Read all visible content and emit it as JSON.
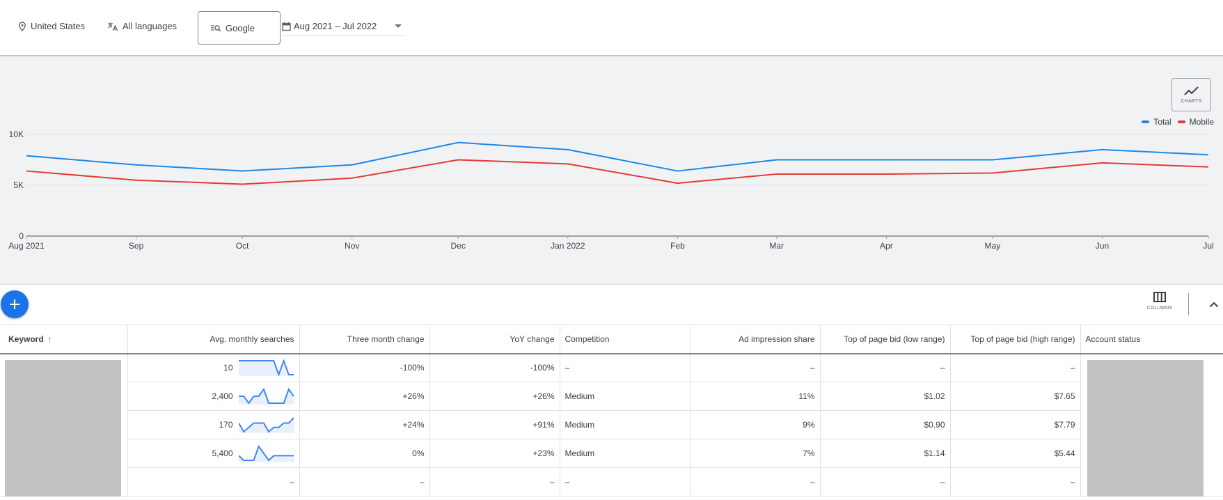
{
  "topbar": {
    "location": {
      "label": "United States",
      "icon": "location-pin-icon"
    },
    "language": {
      "label": "All languages",
      "icon": "translate-icon"
    },
    "network": {
      "label": "Google",
      "icon": "search-network-icon"
    },
    "date_range": {
      "label": "Aug 2021 – Jul 2022",
      "icon": "calendar-icon"
    }
  },
  "charts_button": {
    "label": "CHARTS",
    "icon": "line-chart-icon"
  },
  "colors": {
    "total": "#1e88e5",
    "mobile": "#e53935",
    "accent": "#1a73e8"
  },
  "chart_data": {
    "type": "line",
    "title": "",
    "xlabel": "",
    "ylabel": "",
    "x": [
      "2021-08",
      "2021-09",
      "2021-10",
      "2021-11",
      "2021-12",
      "2022-01",
      "2022-02",
      "2022-03",
      "2022-04",
      "2022-05",
      "2022-06",
      "2022-07"
    ],
    "x_tick_labels": [
      "Aug 2021",
      "Sep",
      "Oct",
      "Nov",
      "Dec",
      "Jan 2022",
      "Feb",
      "Mar",
      "Apr",
      "May",
      "Jun",
      "Jul"
    ],
    "y_tick_labels": [
      "0",
      "5K",
      "10K"
    ],
    "y_ticks": [
      0,
      5000,
      10000
    ],
    "ylim": [
      0,
      10000
    ],
    "grid": true,
    "legend_position": "top-right",
    "series": [
      {
        "name": "Total",
        "color": "#1e88e5",
        "values": [
          7900,
          7000,
          6400,
          7000,
          9200,
          8500,
          6400,
          7500,
          7500,
          7500,
          8500,
          8000
        ]
      },
      {
        "name": "Mobile",
        "color": "#e53935",
        "values": [
          6400,
          5500,
          5100,
          5700,
          7500,
          7100,
          5200,
          6100,
          6100,
          6200,
          7200,
          6800
        ]
      }
    ]
  },
  "toolbar": {
    "add_icon": "plus-icon",
    "columns_label": "COLUMNS",
    "columns_icon": "columns-icon",
    "collapse_icon": "chevron-up-icon"
  },
  "table": {
    "columns": [
      {
        "label": "Keyword",
        "sorted": "ascending"
      },
      {
        "label": "Avg. monthly searches"
      },
      {
        "label": "Three month change"
      },
      {
        "label": "YoY change"
      },
      {
        "label": "Competition"
      },
      {
        "label": "Ad impression share"
      },
      {
        "label": "Top of page bid (low range)"
      },
      {
        "label": "Top of page bid (high range)"
      },
      {
        "label": "Account status"
      }
    ],
    "rows": [
      {
        "searches": "10",
        "trend": [
          3,
          3,
          3,
          3,
          3,
          3,
          3,
          3,
          0,
          3,
          0,
          0
        ],
        "three_month": "-100%",
        "yoy": "-100%",
        "competition": "–",
        "impression_share": "–",
        "bid_low": "–",
        "bid_high": "–"
      },
      {
        "searches": "2,400",
        "trend": [
          2,
          2,
          1,
          2,
          2,
          3,
          1,
          1,
          1,
          1,
          3,
          2
        ],
        "three_month": "+26%",
        "yoy": "+26%",
        "competition": "Medium",
        "impression_share": "11%",
        "bid_low": "$1.02",
        "bid_high": "$7.65"
      },
      {
        "searches": "170",
        "trend": [
          2,
          0,
          1,
          2,
          2,
          2,
          0,
          1,
          1,
          2,
          2,
          3.2
        ],
        "three_month": "+24%",
        "yoy": "+91%",
        "competition": "Medium",
        "impression_share": "9%",
        "bid_low": "$0.90",
        "bid_high": "$7.79"
      },
      {
        "searches": "5,400",
        "trend": [
          1,
          0,
          0,
          0,
          3,
          1.5,
          0,
          1,
          1,
          1,
          1,
          1
        ],
        "three_month": "0%",
        "yoy": "+23%",
        "competition": "Medium",
        "impression_share": "7%",
        "bid_low": "$1.14",
        "bid_high": "$5.44"
      },
      {
        "searches": "–",
        "trend": null,
        "three_month": "–",
        "yoy": "–",
        "competition": "–",
        "impression_share": "–",
        "bid_low": "–",
        "bid_high": "–"
      }
    ]
  }
}
